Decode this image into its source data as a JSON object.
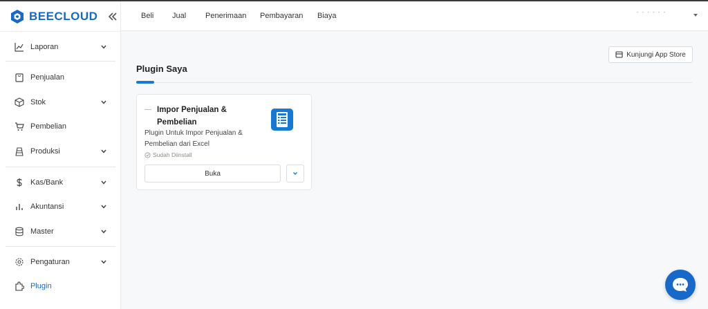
{
  "brand": {
    "name": "BEECLOUD",
    "color": "#1769c9"
  },
  "sidebar": {
    "items": [
      {
        "label": "Laporan",
        "icon": "chart-line-icon",
        "chevron": true
      },
      {
        "label": "Penjualan",
        "icon": "bag-icon",
        "chevron": false
      },
      {
        "label": "Stok",
        "icon": "box-icon",
        "chevron": true
      },
      {
        "label": "Pembelian",
        "icon": "cart-icon",
        "chevron": false
      },
      {
        "label": "Produksi",
        "icon": "factory-icon",
        "chevron": true
      },
      {
        "label": "Kas/Bank",
        "icon": "dollar-icon",
        "chevron": true
      },
      {
        "label": "Akuntansi",
        "icon": "bar-chart-icon",
        "chevron": true
      },
      {
        "label": "Master",
        "icon": "database-icon",
        "chevron": true
      },
      {
        "label": "Pengaturan",
        "icon": "gear-icon",
        "chevron": true
      },
      {
        "label": "Plugin",
        "icon": "plugin-icon",
        "chevron": false,
        "active": true
      }
    ]
  },
  "topnav": {
    "tabs": [
      "Beli",
      "Jual",
      "Penerimaan",
      "Pembayaran",
      "Biaya"
    ]
  },
  "main": {
    "appstore_label": "Kunjungi App Store",
    "page_title": "Plugin Saya",
    "plugin_card": {
      "title": "Impor Penjualan & Pembelian",
      "description": "Plugin Untuk Impor Penjualan & Pembelian dari Excel",
      "status": "Sudah Diinstall",
      "open_label": "Buka"
    }
  },
  "colors": {
    "accent": "#1779d6",
    "active_text": "#1769c9"
  }
}
